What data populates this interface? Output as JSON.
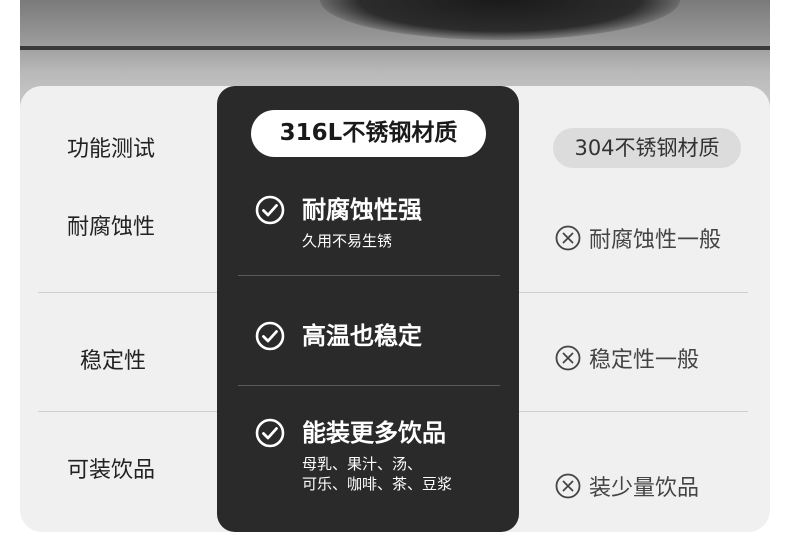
{
  "labels": {
    "header": "功能测试",
    "rows": [
      "耐腐蚀性",
      "稳定性",
      "可装饮品"
    ]
  },
  "center": {
    "tag": "316L不锈钢材质",
    "features": [
      {
        "title": "耐腐蚀性强",
        "sub_lines": [
          "久用不易生锈"
        ]
      },
      {
        "title": "高温也稳定",
        "sub_lines": []
      },
      {
        "title": "能装更多饮品",
        "sub_lines": [
          "母乳、果汁、汤、",
          "可乐、咖啡、茶、豆浆"
        ]
      }
    ]
  },
  "right": {
    "tag": "304不锈钢材质",
    "items": [
      "耐腐蚀性一般",
      "稳定性一般",
      "装少量饮品"
    ]
  },
  "icons": {
    "check": "check-circle-icon",
    "cross": "x-circle-icon"
  },
  "colors": {
    "card": "#2a2a2a",
    "panel": "#f0f0f0",
    "tag_grey": "#dcdcdc"
  }
}
